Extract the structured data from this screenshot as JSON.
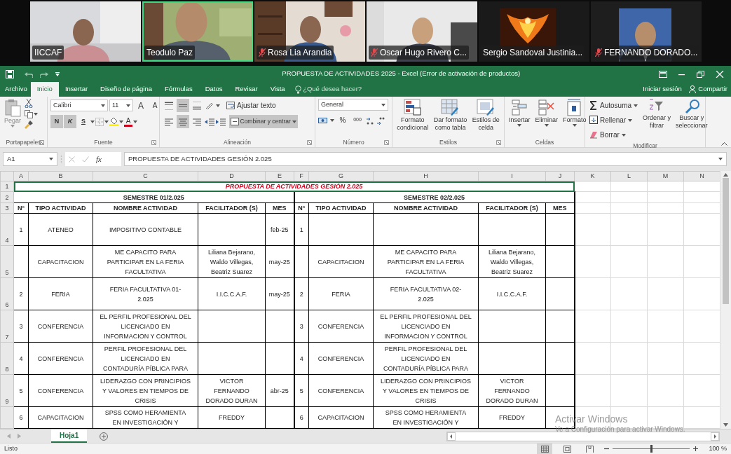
{
  "meeting": {
    "participants": [
      {
        "name": "IICCAF",
        "muted": false,
        "speaking": false
      },
      {
        "name": "Teodulo Paz",
        "muted": false,
        "speaking": true
      },
      {
        "name": "Rosa Lia Arandia",
        "muted": true,
        "speaking": false
      },
      {
        "name": "Oscar Hugo Rivero C...",
        "muted": true,
        "speaking": false
      },
      {
        "name": "Sergio Sandoval Justinia...",
        "muted": false,
        "speaking": false
      },
      {
        "name": "FERNANDO DORADO...",
        "muted": true,
        "speaking": false
      }
    ]
  },
  "title_bar": {
    "title": "PROPUESTA DE ACTIVIDADES 2025 - Excel (Error de activación de productos)"
  },
  "ribbon_tabs": [
    {
      "label": "Archivo",
      "selected": false
    },
    {
      "label": "Inicio",
      "selected": true
    },
    {
      "label": "Insertar",
      "selected": false
    },
    {
      "label": "Diseño de página",
      "selected": false
    },
    {
      "label": "Fórmulas",
      "selected": false
    },
    {
      "label": "Datos",
      "selected": false
    },
    {
      "label": "Revisar",
      "selected": false
    },
    {
      "label": "Vista",
      "selected": false
    }
  ],
  "tell_me": {
    "placeholder": "¿Qué desea hacer?"
  },
  "sign_in": "Iniciar sesión",
  "share": "Compartir",
  "ribbon": {
    "clipboard": {
      "group": "Portapapeles",
      "paste": "Pegar"
    },
    "font": {
      "group": "Fuente",
      "name": "Calibri",
      "size": "11",
      "grow": "A",
      "shrink": "A",
      "bold": {
        "label": "N",
        "pressed": true
      },
      "italic": {
        "label": "K",
        "pressed": true
      },
      "underline": {
        "label": "S",
        "pressed": false
      },
      "color_letter": "A"
    },
    "alignment": {
      "group": "Alineación",
      "vertical": [
        {
          "selected": false
        },
        {
          "selected": true
        },
        {
          "selected": false
        }
      ],
      "horizontal": [
        {
          "selected": false
        },
        {
          "selected": true
        },
        {
          "selected": false
        }
      ],
      "wrap": "Ajustar texto",
      "merge": {
        "label": "Combinar y centrar",
        "pressed": true
      }
    },
    "number": {
      "group": "Número",
      "format": "General",
      "percent": "%",
      "thousands": "000"
    },
    "styles": {
      "group": "Estilos",
      "buttons": [
        {
          "lines": [
            "Formato",
            "condicional"
          ]
        },
        {
          "lines": [
            "Dar formato",
            "como tabla"
          ]
        },
        {
          "lines": [
            "Estilos de",
            "celda"
          ]
        }
      ]
    },
    "cells": {
      "group": "Celdas",
      "buttons": [
        "Insertar",
        "Eliminar",
        "Formato"
      ]
    },
    "editing": {
      "group": "Modificar",
      "items": [
        "Autosuma",
        "Rellenar",
        "Borrar"
      ],
      "buttons": [
        {
          "lines": [
            "Ordenar y",
            "filtrar"
          ]
        },
        {
          "lines": [
            "Buscar y",
            "seleccionar"
          ]
        }
      ]
    }
  },
  "formula_bar": {
    "name_box": "A1",
    "fx": "fx",
    "formula": "PROPUESTA DE ACTIVIDADES GESIÓN 2.025"
  },
  "sheet": {
    "columns": [
      "A",
      "B",
      "C",
      "D",
      "E",
      "F",
      "G",
      "H",
      "I",
      "J",
      "K",
      "L",
      "M",
      "N"
    ],
    "rows": [
      "1",
      "2",
      "3",
      "4",
      "5",
      "6",
      "7",
      "8",
      "9"
    ],
    "title": {
      "text": "PROPUESTA DE ACTIVIDADES GESIÓN 2.025",
      "selected": true
    },
    "semesters": [
      {
        "title": "SEMESTRE 01/2.025",
        "headers": [
          "N°",
          "TIPO ACTIVIDAD",
          "NOMBRE ACTIVIDAD",
          "FACILITADOR (S)",
          "MES"
        ],
        "rows": [
          {
            "n": "1",
            "tipo": "ATENEO",
            "nombre": [
              "IMPOSITIVO CONTABLE"
            ],
            "mes": "feb-25"
          },
          {
            "tipo": "CAPACITACION",
            "nombre": [
              "ME CAPACITO PARA",
              "PARTICIPAR EN LA FERIA",
              "FACULTATIVA"
            ],
            "facilitador": [
              "Liliana Bejarano,",
              "Waldo Villegas,",
              "Beatriz Suarez"
            ],
            "mes": "may-25"
          },
          {
            "n": "2",
            "tipo": "FERIA",
            "nombre": [
              "FERIA FACULTATIVA 01-",
              "2.025"
            ],
            "facilitador": [
              "I.I.C.C.A.F."
            ],
            "mes": "may-25"
          },
          {
            "n": "3",
            "tipo": "CONFERENCIA",
            "nombre": [
              "EL PERFIL PROFESIONAL DEL",
              "LICENCIADO EN",
              "INFORMACION Y CONTROL"
            ]
          },
          {
            "n": "4",
            "tipo": "CONFERENCIA",
            "nombre": [
              "PERFIL PROFESIONAL DEL",
              "LICENCIADO EN",
              "CONTADURÍA PÍBLICA PARA"
            ]
          },
          {
            "n": "5",
            "tipo": "CONFERENCIA",
            "nombre": [
              "LIDERAZGO CON PRINCIPIOS",
              "Y VALORES EN TIEMPOS DE",
              "CRISIS"
            ],
            "facilitador": [
              "VICTOR",
              "FERNANDO",
              "DORADO DURAN"
            ],
            "mes": "abr-25"
          },
          {
            "n": "6",
            "tipo": "CAPACITACION",
            "nombre": [
              "SPSS COMO HERAMIENTA",
              "EN INVESTIGACIÓN Y"
            ],
            "facilitador": [
              "FREDDY"
            ]
          }
        ]
      },
      {
        "title": "SEMESTRE 02/2.025",
        "headers": [
          "N°",
          "TIPO ACTIVIDAD",
          "NOMBRE ACTIVIDAD",
          "FACILITADOR (S)",
          "MES"
        ],
        "rows": [
          {
            "n": "1"
          },
          {
            "tipo": "CAPACITACION",
            "nombre": [
              "ME CAPACITO PARA",
              "PARTICIPAR EN LA FERIA",
              "FACULTATIVA"
            ],
            "facilitador": [
              "Liliana Bejarano,",
              "Waldo Villegas,",
              "Beatriz Suarez"
            ]
          },
          {
            "n": "2",
            "tipo": "FERIA",
            "nombre": [
              "FERIA FACULTATIVA 02-",
              "2.025"
            ],
            "facilitador": [
              "I.I.C.C.A.F."
            ]
          },
          {
            "n": "3",
            "tipo": "CONFERENCIA",
            "nombre": [
              "EL PERFIL PROFESIONAL DEL",
              "LICENCIADO EN",
              "INFORMACION Y CONTROL"
            ]
          },
          {
            "n": "4",
            "tipo": "CONFERENCIA",
            "nombre": [
              "PERFIL PROFESIONAL DEL",
              "LICENCIADO EN",
              "CONTADURÍA PÍBLICA PARA"
            ]
          },
          {
            "n": "5",
            "tipo": "CONFERENCIA",
            "nombre": [
              "LIDERAZGO CON PRINCIPIOS",
              "Y VALORES EN TIEMPOS DE",
              "CRISIS"
            ],
            "facilitador": [
              "VICTOR",
              "FERNANDO",
              "DORADO DURAN"
            ]
          },
          {
            "n": "6",
            "tipo": "CAPACITACION",
            "nombre": [
              "SPSS COMO HERAMIENTA",
              "EN INVESTIGACIÓN Y"
            ],
            "facilitador": [
              "FREDDY"
            ]
          }
        ]
      }
    ]
  },
  "sheet_tabs": [
    {
      "label": "Hoja1",
      "selected": true
    }
  ],
  "status_bar": {
    "status": "Listo",
    "views": [
      {
        "selected": true
      },
      {
        "selected": false
      },
      {
        "selected": false
      }
    ],
    "zoom": {
      "level": 0.5,
      "reading": "100 %"
    }
  },
  "activation_notice": {
    "title": "Activar Windows",
    "message": "Ve a Configuración para activar Windows."
  }
}
